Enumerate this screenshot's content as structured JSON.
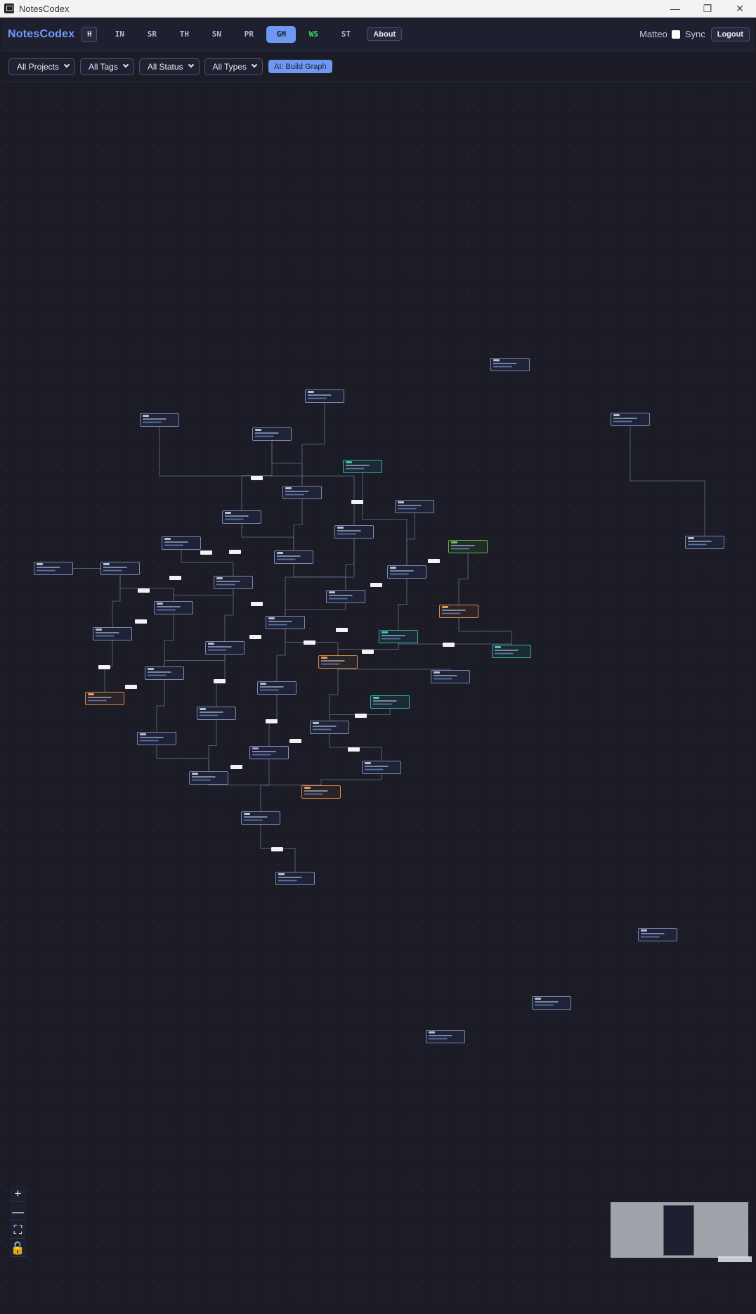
{
  "window": {
    "title": "NotesCodex",
    "controls": [
      "—",
      "❐",
      "✕"
    ]
  },
  "navbar": {
    "brand": "NotesCodex",
    "home_label": "H",
    "tabs": [
      {
        "label": "IN",
        "active": false
      },
      {
        "label": "SR",
        "active": false
      },
      {
        "label": "TH",
        "active": false
      },
      {
        "label": "SN",
        "active": false
      },
      {
        "label": "PR",
        "active": false
      },
      {
        "label": "GM",
        "active": true
      },
      {
        "label": "WS",
        "active": false
      },
      {
        "label": "ST",
        "active": false
      }
    ],
    "about_label": "About",
    "user": "Matteo",
    "sync_label": "Sync",
    "sync_checked": false,
    "logout_label": "Logout"
  },
  "filters": {
    "projects": "All Projects",
    "tags": "All Tags",
    "status": "All Status",
    "types": "All Types",
    "ai_button": "AI: Build Graph"
  },
  "controls": {
    "zoom_in": "+",
    "zoom_out": "—",
    "fit_view": "⛶",
    "lock": "🔓"
  },
  "colors": {
    "accent": "#6f98f0",
    "ws_tab": "#36e070",
    "node_default": "#7f86a8",
    "node_teal": "#3fa9a0",
    "node_orange": "#d98a48",
    "node_green": "#6bb44e",
    "node_purple": "#9a86d8"
  }
}
